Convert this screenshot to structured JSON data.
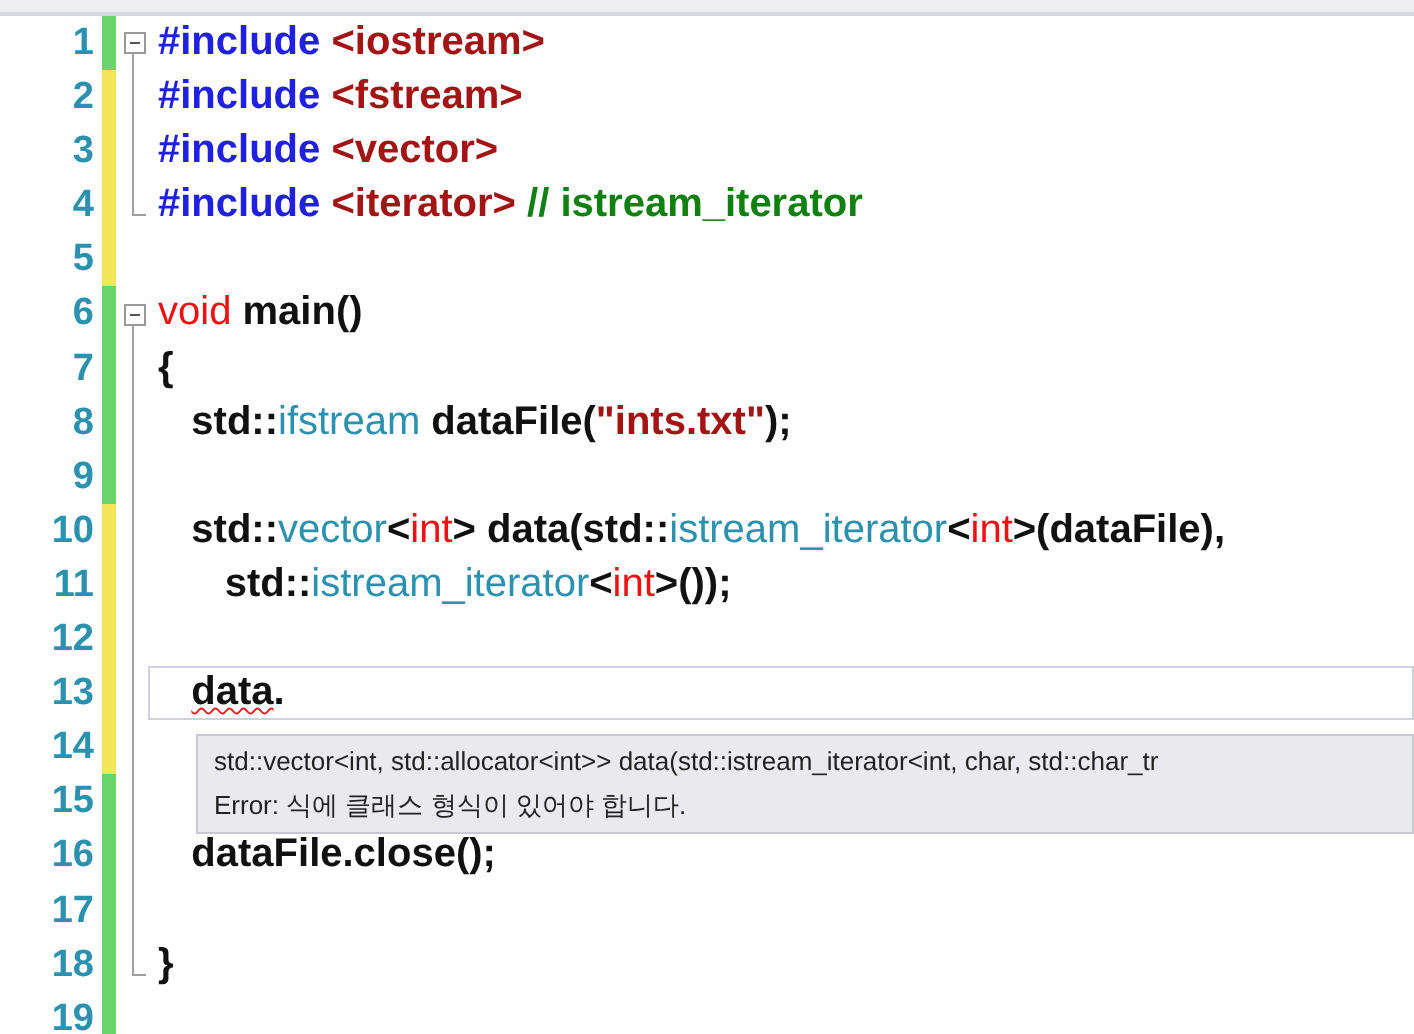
{
  "editor": {
    "lines": [
      {
        "number": "1",
        "modified": false,
        "fold_start": true,
        "in_fold": true,
        "fold_end": false,
        "current": false,
        "tokens": [
          {
            "kind": "directive",
            "text": "#include "
          },
          {
            "kind": "header",
            "text": "<iostream>"
          }
        ]
      },
      {
        "number": "2",
        "modified": true,
        "fold_start": false,
        "in_fold": true,
        "fold_end": false,
        "current": false,
        "tokens": [
          {
            "kind": "directive",
            "text": "#include "
          },
          {
            "kind": "header",
            "text": "<fstream>"
          }
        ]
      },
      {
        "number": "3",
        "modified": true,
        "fold_start": false,
        "in_fold": true,
        "fold_end": false,
        "current": false,
        "tokens": [
          {
            "kind": "directive",
            "text": "#include "
          },
          {
            "kind": "header",
            "text": "<vector>"
          }
        ]
      },
      {
        "number": "4",
        "modified": true,
        "fold_start": false,
        "in_fold": true,
        "fold_end": true,
        "current": false,
        "tokens": [
          {
            "kind": "directive",
            "text": "#include "
          },
          {
            "kind": "header",
            "text": "<iterator>"
          },
          {
            "kind": "comment",
            "text": " // istream_iterator"
          }
        ]
      },
      {
        "number": "5",
        "modified": true,
        "fold_start": false,
        "in_fold": false,
        "fold_end": false,
        "current": false
      },
      {
        "number": "6",
        "modified": false,
        "fold_start": true,
        "in_fold": true,
        "fold_end": false,
        "current": false,
        "tokens": [
          {
            "kind": "keyword",
            "text": "void"
          },
          {
            "kind": "plain",
            "text": " main()"
          }
        ]
      },
      {
        "number": "7",
        "modified": false,
        "fold_start": false,
        "in_fold": true,
        "fold_end": false,
        "current": false,
        "tokens": [
          {
            "kind": "plain",
            "text": "{"
          }
        ]
      },
      {
        "number": "8",
        "modified": false,
        "fold_start": false,
        "in_fold": true,
        "fold_end": false,
        "current": false,
        "tokens": [
          {
            "kind": "plain",
            "text": "   std::"
          },
          {
            "kind": "type",
            "text": "ifstream"
          },
          {
            "kind": "plain",
            "text": " dataFile("
          },
          {
            "kind": "string",
            "text": "\"ints.txt\""
          },
          {
            "kind": "plain",
            "text": ");"
          }
        ]
      },
      {
        "number": "9",
        "modified": false,
        "fold_start": false,
        "in_fold": true,
        "fold_end": false,
        "current": false
      },
      {
        "number": "10",
        "modified": true,
        "fold_start": false,
        "in_fold": true,
        "fold_end": false,
        "current": false,
        "tokens": [
          {
            "kind": "plain",
            "text": "   std::"
          },
          {
            "kind": "type",
            "text": "vector"
          },
          {
            "kind": "plain",
            "text": "<"
          },
          {
            "kind": "keyword",
            "text": "int"
          },
          {
            "kind": "plain",
            "text": "> data(std::"
          },
          {
            "kind": "type",
            "text": "istream_iterator"
          },
          {
            "kind": "plain",
            "text": "<"
          },
          {
            "kind": "keyword",
            "text": "int"
          },
          {
            "kind": "plain",
            "text": ">(dataFile),"
          }
        ]
      },
      {
        "number": "11",
        "modified": true,
        "fold_start": false,
        "in_fold": true,
        "fold_end": false,
        "current": false,
        "tokens": [
          {
            "kind": "plain",
            "text": "      std::"
          },
          {
            "kind": "type",
            "text": "istream_iterator"
          },
          {
            "kind": "plain",
            "text": "<"
          },
          {
            "kind": "keyword",
            "text": "int"
          },
          {
            "kind": "plain",
            "text": ">());"
          }
        ]
      },
      {
        "number": "12",
        "modified": true,
        "fold_start": false,
        "in_fold": true,
        "fold_end": false,
        "current": false
      },
      {
        "number": "13",
        "modified": true,
        "fold_start": false,
        "in_fold": true,
        "fold_end": false,
        "current": true,
        "tokens": [
          {
            "kind": "error",
            "text": "   data"
          },
          {
            "kind": "plain",
            "text": "."
          }
        ]
      },
      {
        "number": "14",
        "modified": true,
        "fold_start": false,
        "in_fold": true,
        "fold_end": false,
        "current": false
      },
      {
        "number": "15",
        "modified": false,
        "fold_start": false,
        "in_fold": true,
        "fold_end": false,
        "current": false
      },
      {
        "number": "16",
        "modified": false,
        "fold_start": false,
        "in_fold": true,
        "fold_end": false,
        "current": false,
        "tokens": [
          {
            "kind": "plain",
            "text": "   dataFile.close();"
          }
        ]
      },
      {
        "number": "17",
        "modified": false,
        "fold_start": false,
        "in_fold": true,
        "fold_end": false,
        "current": false
      },
      {
        "number": "18",
        "modified": false,
        "fold_start": false,
        "in_fold": true,
        "fold_end": true,
        "current": false,
        "tokens": [
          {
            "kind": "plain",
            "text": "}"
          }
        ]
      },
      {
        "number": "19",
        "modified": false,
        "fold_start": false,
        "in_fold": false,
        "fold_end": false,
        "current": false
      }
    ]
  },
  "tooltip": {
    "signature": "std::vector<int, std::allocator<int>> data(std::istream_iterator<int, char, std::char_tr",
    "error": "Error: 식에 클래스 형식이 있어야 합니다."
  }
}
